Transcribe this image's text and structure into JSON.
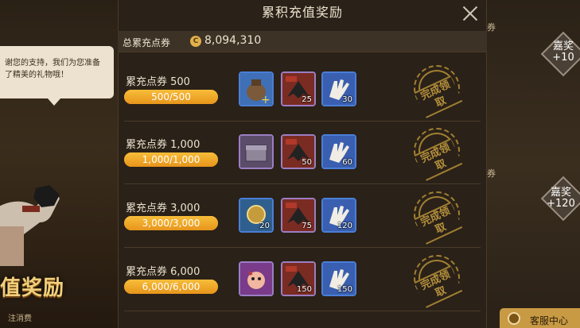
{
  "panel": {
    "title": "累积充值奖励",
    "total_label": "总累充点券",
    "coin_symbol": "C",
    "total_value": "8,094,310"
  },
  "promo": {
    "speech": "谢您的支持，我们为您准备了精美的礼物哦！",
    "title": "值奖励",
    "subtitle": "注消费"
  },
  "right_side": {
    "tag_top": "券",
    "tag_mid": "券",
    "badge1_text": "嘉奖",
    "badge1_value": "+10",
    "badge2_text": "嘉奖",
    "badge2_value": "+120",
    "service_label": "客服中心"
  },
  "tiers": [
    {
      "label": "累充点券  500",
      "progress_text": "500/500",
      "progress": 1.0,
      "items": [
        {
          "icon": "money-bag-icon",
          "qty": "",
          "border": "blue"
        },
        {
          "icon": "dark-cape-icon",
          "qty": "25",
          "border": "purple"
        },
        {
          "icon": "white-glove-icon",
          "qty": "30",
          "border": "blue"
        }
      ],
      "stamp": "完成领取"
    },
    {
      "label": "累充点券  1,000",
      "progress_text": "1,000/1,000",
      "progress": 1.0,
      "items": [
        {
          "icon": "treasure-box-icon",
          "qty": "",
          "border": "purple"
        },
        {
          "icon": "dark-cape-icon",
          "qty": "50",
          "border": "purple"
        },
        {
          "icon": "white-glove-icon",
          "qty": "60",
          "border": "blue"
        }
      ],
      "stamp": "完成领取"
    },
    {
      "label": "累充点券  3,000",
      "progress_text": "3,000/3,000",
      "progress": 1.0,
      "items": [
        {
          "icon": "gold-coin-icon",
          "qty": "20",
          "border": "blue"
        },
        {
          "icon": "dark-cape-icon",
          "qty": "75",
          "border": "purple"
        },
        {
          "icon": "white-glove-icon",
          "qty": "120",
          "border": "blue"
        }
      ],
      "stamp": "完成领取"
    },
    {
      "label": "累充点券  6,000",
      "progress_text": "6,000/6,000",
      "progress": 1.0,
      "items": [
        {
          "icon": "pig-pet-icon",
          "qty": "",
          "border": "purple"
        },
        {
          "icon": "dark-cape-icon",
          "qty": "150",
          "border": "purple"
        },
        {
          "icon": "white-glove-icon",
          "qty": "150",
          "border": "blue"
        }
      ],
      "stamp": "完成领取"
    }
  ],
  "colors": {
    "progress_fill": "#f0a72a",
    "stamp": "#a07f32",
    "panel_bg": "#2a2118"
  }
}
